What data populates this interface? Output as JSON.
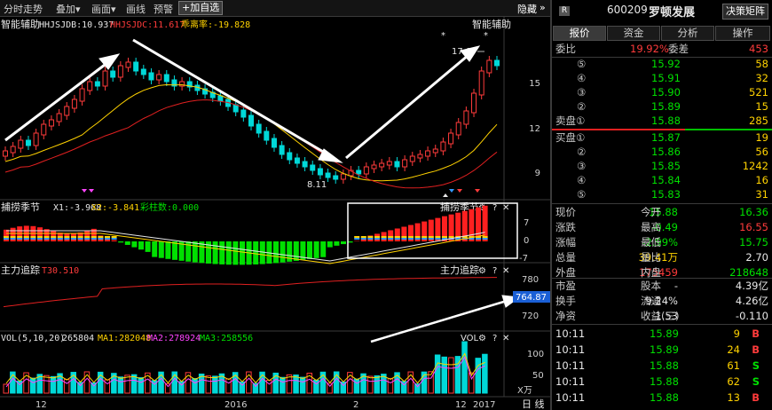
{
  "toolbar": {
    "items": [
      "分时走势",
      "叠加▾",
      "画面▾",
      "画线",
      "预警"
    ],
    "add_watch": "+加自选",
    "hide": "隐藏"
  },
  "main_chart": {
    "indicator_name": "智能辅助",
    "legend": [
      {
        "label": "HHJSJDB:10.937",
        "color": "#e6e6e6"
      },
      {
        "label": "HHJSJDC:11.617",
        "color": "#ff3b3b"
      },
      {
        "label": "乖离率:-19.828",
        "color": "#ffd200"
      }
    ],
    "right_title": "智能辅助",
    "y_labels": [
      "15",
      "12",
      "9"
    ],
    "high_label": "17.07",
    "low_label": "8.11",
    "star": "*"
  },
  "panel2": {
    "title": "捕捞季节",
    "legend": [
      {
        "label": "X1:-3.968",
        "color": "#e6e6e6"
      },
      {
        "label": "X2:-3.841",
        "color": "#ffd200"
      },
      {
        "label": "彩柱数:0.000",
        "color": "#00e000"
      }
    ],
    "right_title": "捕捞季节",
    "y_labels": [
      "7",
      "0",
      "-7"
    ]
  },
  "panel3": {
    "title": "主力追踪",
    "legend": [
      {
        "label": "T30.510",
        "color": "#ff3b3b"
      }
    ],
    "right_title": "主力追踪",
    "y_labels": [
      "780",
      "720"
    ],
    "current_value": "764.87"
  },
  "panel4": {
    "title": "VOL(5,10,20)",
    "legend": [
      {
        "label": "265804",
        "color": "#e6e6e6"
      },
      {
        "label": "MA1:282048",
        "color": "#ffd200"
      },
      {
        "label": "MA2:278924",
        "color": "#ff44ff"
      },
      {
        "label": "MA3:258556",
        "color": "#00e000"
      }
    ],
    "right_title": "VOL",
    "y_labels": [
      "100",
      "50"
    ],
    "unit": "X万"
  },
  "x_axis": {
    "labels": [
      "12",
      "2016",
      "2",
      "12",
      "2017"
    ],
    "period": "日 线"
  },
  "quote": {
    "badge": "R",
    "code": "600209",
    "name": "罗顿发展",
    "decision_button": "决策矩阵",
    "tabs": [
      "报价",
      "资金",
      "分析",
      "操作"
    ],
    "ratio": {
      "label": "委比",
      "value": "19.92%",
      "label2": "委差",
      "value2": "453"
    },
    "asks": [
      {
        "label": "⑤",
        "price": "15.92",
        "vol": "58"
      },
      {
        "label": "④",
        "price": "15.91",
        "vol": "32"
      },
      {
        "label": "③",
        "price": "15.90",
        "vol": "521"
      },
      {
        "label": "②",
        "price": "15.89",
        "vol": "15"
      },
      {
        "label": "卖盘①",
        "price": "15.88",
        "vol": "285"
      }
    ],
    "bids": [
      {
        "label": "买盘①",
        "price": "15.87",
        "vol": "19"
      },
      {
        "label": "②",
        "price": "15.86",
        "vol": "56"
      },
      {
        "label": "③",
        "price": "15.85",
        "vol": "1242"
      },
      {
        "label": "④",
        "price": "15.84",
        "vol": "16"
      },
      {
        "label": "⑤",
        "price": "15.83",
        "vol": "31"
      }
    ],
    "stats": [
      {
        "l1": "现价",
        "v1": "15.88",
        "c1": "#00e000",
        "l2": "今开",
        "v2": "16.36",
        "c2": "#00e000"
      },
      {
        "l1": "涨跌",
        "v1": "-0.49",
        "c1": "#00e000",
        "l2": "最高",
        "v2": "16.55",
        "c2": "#ff3b3b"
      },
      {
        "l1": "涨幅",
        "v1": "-2.99%",
        "c1": "#00e000",
        "l2": "最低",
        "v2": "15.75",
        "c2": "#00e000"
      },
      {
        "l1": "总量",
        "v1": "39.41万",
        "c1": "#ffd200",
        "l2": "量比",
        "v2": "2.70",
        "c2": "#e8e8e8"
      },
      {
        "l1": "外盘",
        "v1": "175459",
        "c1": "#ff3b3b",
        "l2": "内盘",
        "v2": "218648",
        "c2": "#00e000"
      }
    ],
    "stats2": [
      {
        "l1": "市盈",
        "v1": "-",
        "c1": "#e8e8e8",
        "l2": "股本",
        "v2": "4.39亿",
        "c2": "#e8e8e8"
      },
      {
        "l1": "换手",
        "v1": "9.24%",
        "c1": "#e8e8e8",
        "l2": "流通",
        "v2": "4.26亿",
        "c2": "#e8e8e8"
      },
      {
        "l1": "净资",
        "v1": "1.53",
        "c1": "#e8e8e8",
        "l2": "收益(三)",
        "v2": "-0.110",
        "c2": "#e8e8e8"
      }
    ],
    "ticks": [
      {
        "time": "10:11",
        "price": "15.89",
        "vol": "9",
        "side": "B",
        "color": "#ff3b3b"
      },
      {
        "time": "10:11",
        "price": "15.89",
        "vol": "24",
        "side": "B",
        "color": "#ff3b3b"
      },
      {
        "time": "10:11",
        "price": "15.88",
        "vol": "61",
        "side": "S",
        "color": "#00e000"
      },
      {
        "time": "10:11",
        "price": "15.88",
        "vol": "62",
        "side": "S",
        "color": "#00e000"
      },
      {
        "time": "10:11",
        "price": "15.88",
        "vol": "13",
        "side": "B",
        "color": "#ff3b3b"
      }
    ]
  }
}
